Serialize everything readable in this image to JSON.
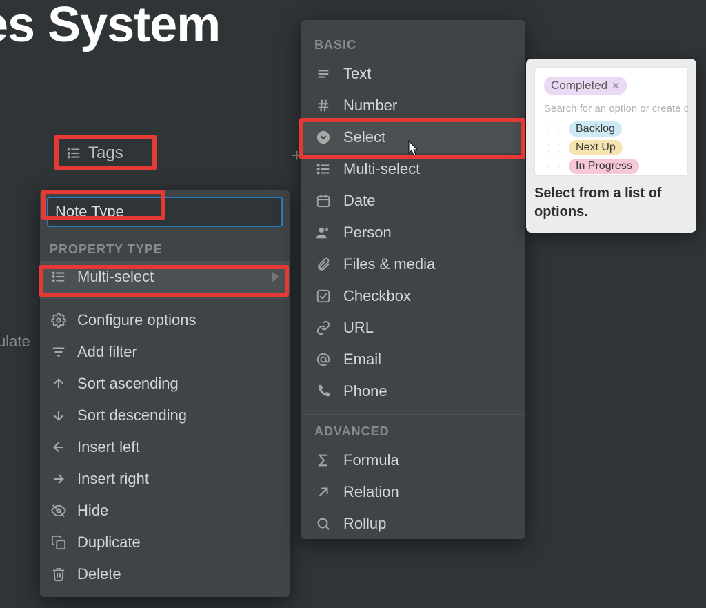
{
  "page": {
    "title": "Notes System"
  },
  "column": {
    "header": "Tags",
    "name_input_value": "Note Type"
  },
  "left_menu": {
    "section_label": "PROPERTY TYPE",
    "current_type": "Multi-select",
    "actions": {
      "configure": "Configure options",
      "add_filter": "Add filter",
      "sort_asc": "Sort ascending",
      "sort_desc": "Sort descending",
      "insert_left": "Insert left",
      "insert_right": "Insert right",
      "hide": "Hide",
      "duplicate": "Duplicate",
      "delete": "Delete"
    }
  },
  "type_menu": {
    "basic_label": "BASIC",
    "advanced_label": "ADVANCED",
    "basic": {
      "text": "Text",
      "number": "Number",
      "select": "Select",
      "multiselect": "Multi-select",
      "date": "Date",
      "person": "Person",
      "files": "Files & media",
      "checkbox": "Checkbox",
      "url": "URL",
      "email": "Email",
      "phone": "Phone"
    },
    "advanced": {
      "formula": "Formula",
      "relation": "Relation",
      "rollup": "Rollup"
    }
  },
  "tooltip": {
    "completed_tag": "Completed",
    "search_placeholder": "Search for an option or create on",
    "options": {
      "backlog": "Backlog",
      "nextup": "Next Up",
      "inprogress": "In Progress"
    },
    "description": "Select from a list of options."
  },
  "fragment": "ulate"
}
